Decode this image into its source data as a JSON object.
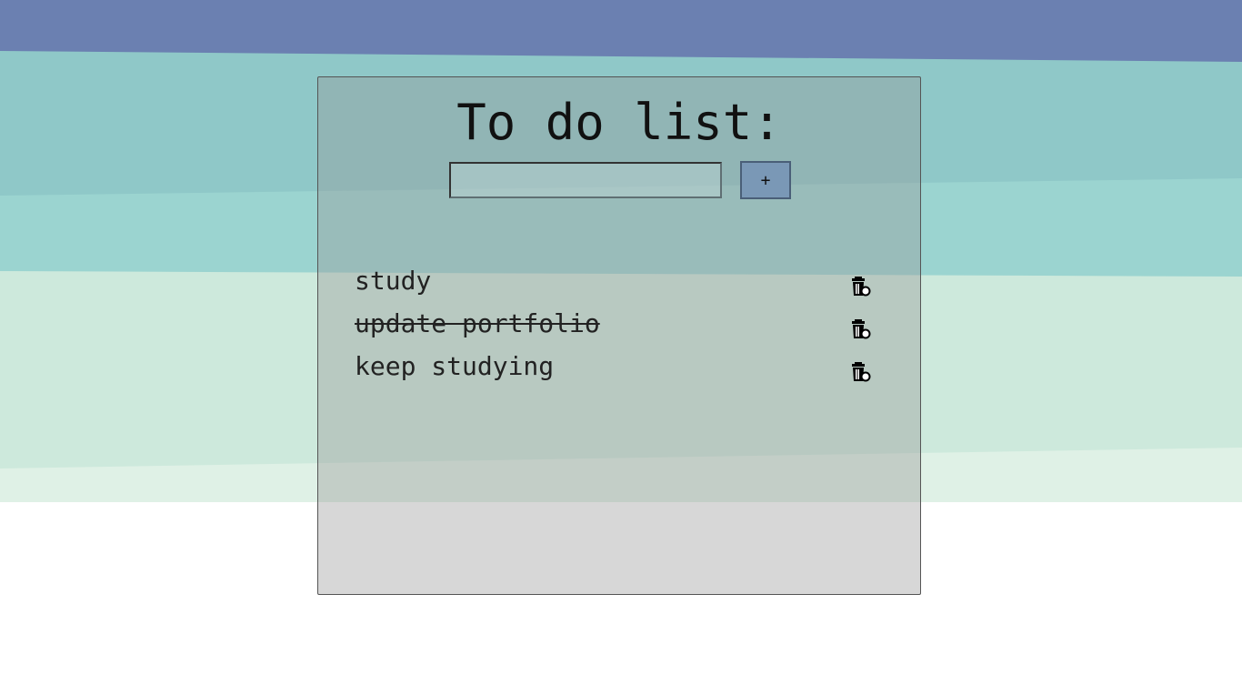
{
  "colors": {
    "band_top": "#6b80b1",
    "band_2": "#8fc8c8",
    "band_3": "#9bd4d0",
    "band_4": "#cde9dc",
    "band_5": "#dff1e6",
    "card_bg": "rgba(150,150,150,0.38)",
    "button_bg": "#7a98b6"
  },
  "app": {
    "title": "To do list:"
  },
  "form": {
    "input_value": "",
    "input_placeholder": "",
    "add_label": "+"
  },
  "todos": [
    {
      "text": "study",
      "done": false,
      "delete_icon": "trash-icon"
    },
    {
      "text": "update portfolio",
      "done": true,
      "delete_icon": "trash-icon"
    },
    {
      "text": "keep studying",
      "done": false,
      "delete_icon": "trash-icon"
    }
  ]
}
